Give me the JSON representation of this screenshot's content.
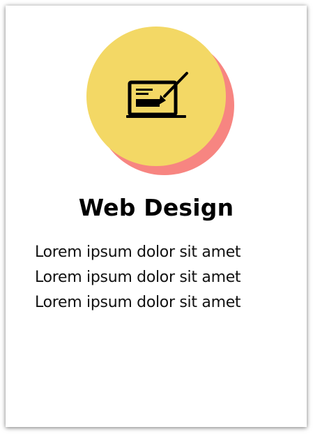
{
  "card": {
    "icon": "web-design-laptop-pen-icon",
    "title": "Web Design",
    "lines": [
      "Lorem ipsum dolor sit amet",
      "Lorem ipsum dolor sit amet",
      "Lorem ipsum dolor sit amet"
    ]
  },
  "colors": {
    "circle_front": "#f3d865",
    "circle_back": "#f78581",
    "text": "#000000"
  }
}
